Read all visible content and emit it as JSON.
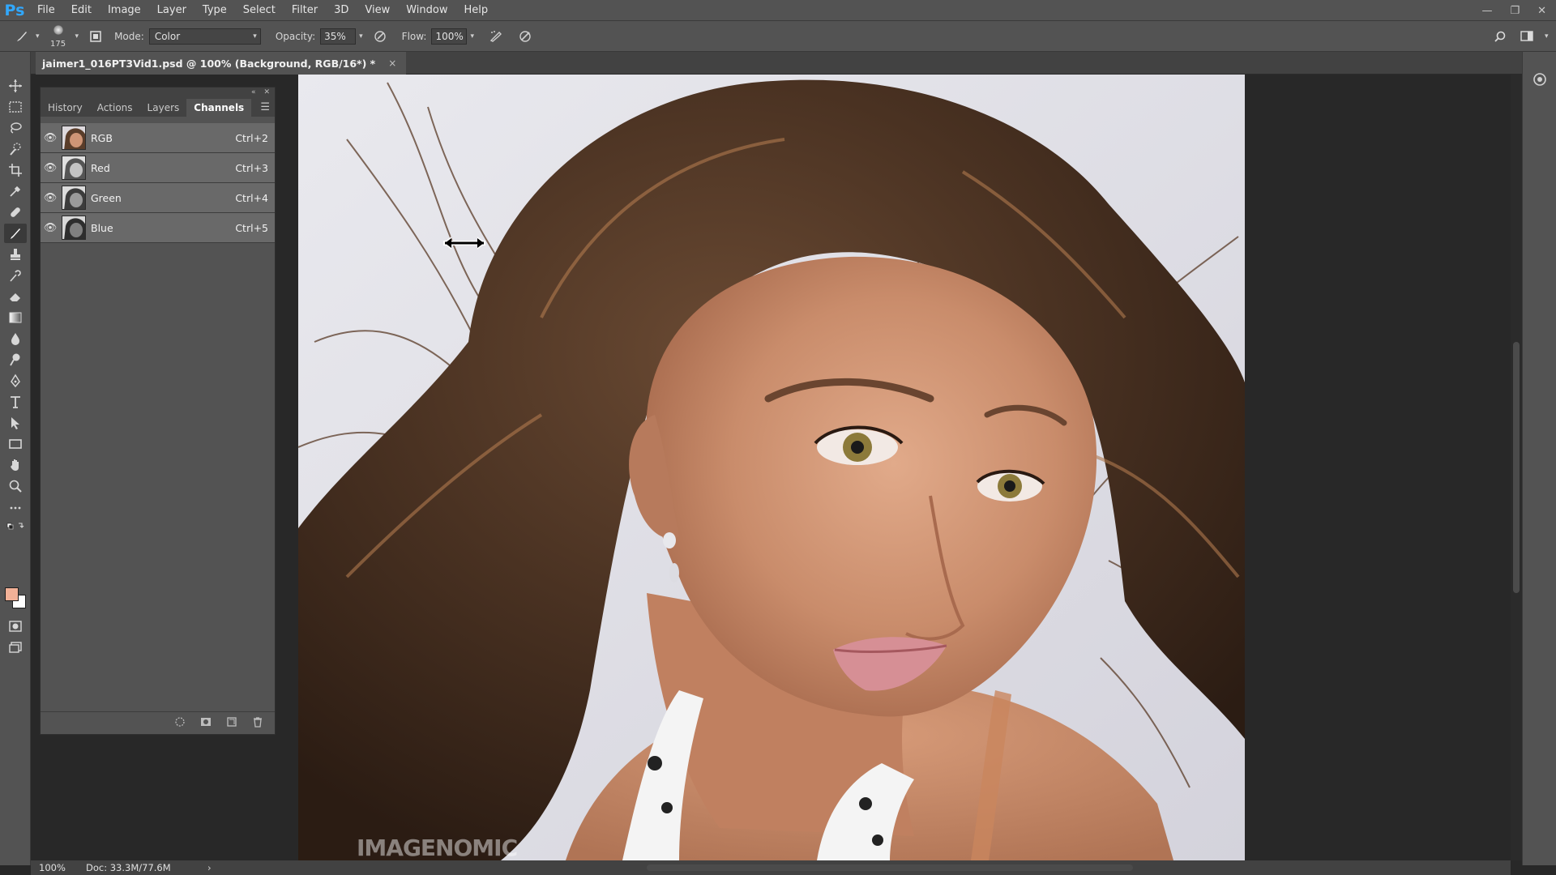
{
  "app": {
    "logo": "Ps",
    "menu": [
      "File",
      "Edit",
      "Image",
      "Layer",
      "Type",
      "Select",
      "Filter",
      "3D",
      "View",
      "Window",
      "Help"
    ]
  },
  "options": {
    "brush_size": "175",
    "mode_label": "Mode:",
    "mode_value": "Color",
    "opacity_label": "Opacity:",
    "opacity_value": "35%",
    "flow_label": "Flow:",
    "flow_value": "100%"
  },
  "document": {
    "tab_title": "jaimer1_016PT3Vid1.psd @ 100% (Background, RGB/16*) *",
    "close": "×"
  },
  "panel": {
    "tabs": [
      "History",
      "Actions",
      "Layers",
      "Channels"
    ],
    "active_tab": "Channels",
    "channels": [
      {
        "name": "RGB",
        "shortcut": "Ctrl+2"
      },
      {
        "name": "Red",
        "shortcut": "Ctrl+3"
      },
      {
        "name": "Green",
        "shortcut": "Ctrl+4"
      },
      {
        "name": "Blue",
        "shortcut": "Ctrl+5"
      }
    ]
  },
  "status": {
    "zoom": "100%",
    "doc": "Doc: 33.3M/77.6M"
  },
  "watermark": "IMAGENOMIC",
  "colors": {
    "foreground": "#f2b197",
    "background": "#ffffff",
    "ps_blue": "#31a8ff"
  }
}
